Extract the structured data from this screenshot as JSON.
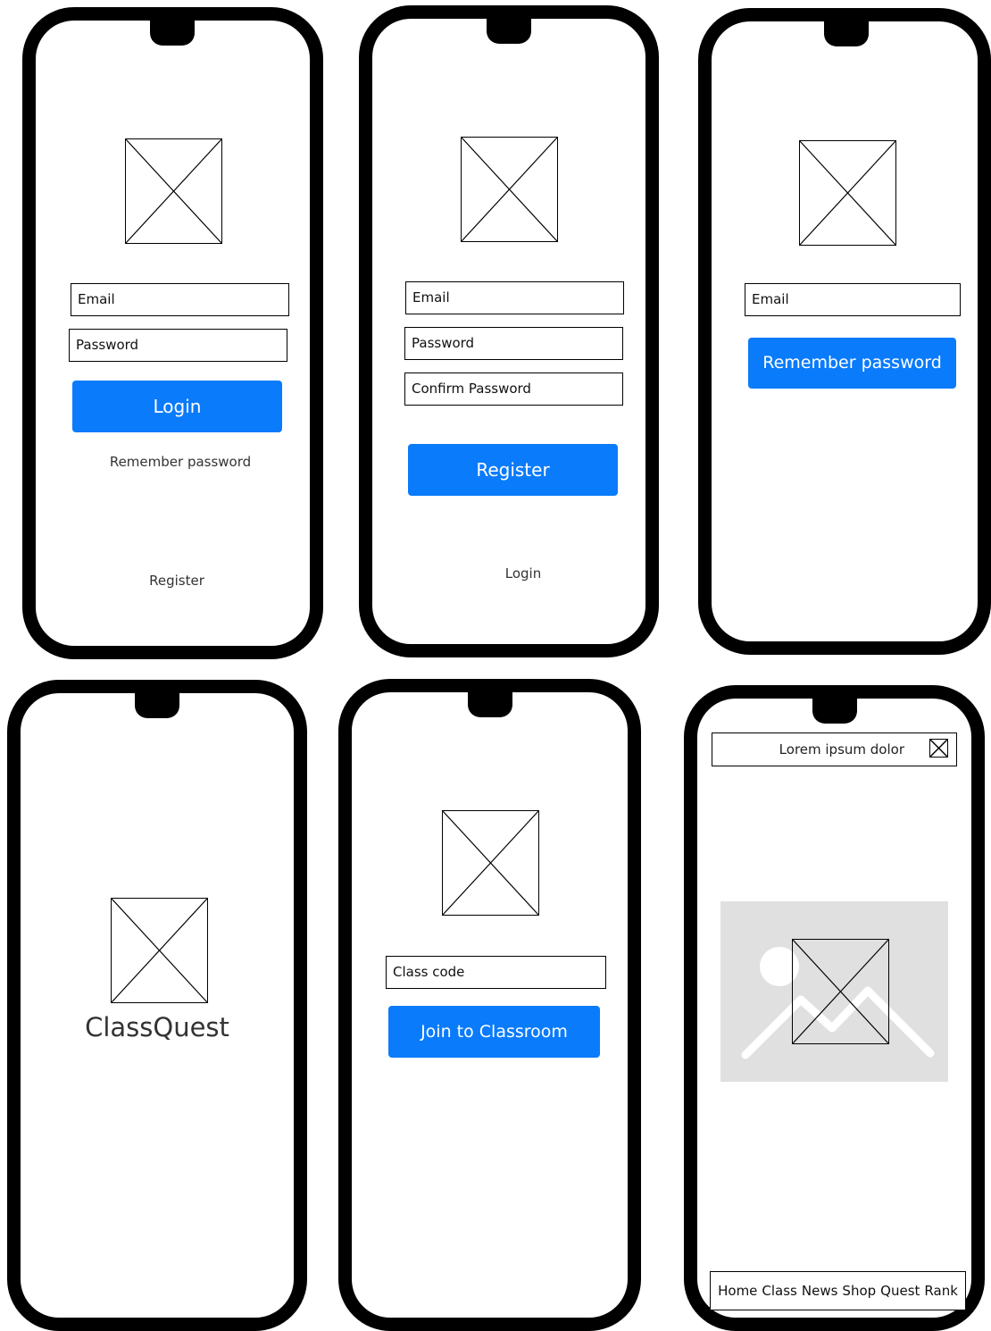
{
  "login_screen": {
    "email_placeholder": "Email",
    "password_placeholder": "Password",
    "login_button": "Login",
    "remember_link": "Remember password",
    "register_link": "Register",
    "logo_icon": "image-placeholder-icon"
  },
  "register_screen": {
    "email_placeholder": "Email",
    "password_placeholder": "Password",
    "confirm_password_placeholder": "Confirm Password",
    "register_button": "Register",
    "login_link": "Login",
    "logo_icon": "image-placeholder-icon"
  },
  "recover_screen": {
    "email_placeholder": "Email",
    "remember_button": "Remember password",
    "logo_icon": "image-placeholder-icon"
  },
  "splash_screen": {
    "app_name": "ClassQuest",
    "logo_icon": "image-placeholder-icon"
  },
  "join_screen": {
    "class_code_placeholder": "Class code",
    "join_button": "Join to Classroom",
    "logo_icon": "image-placeholder-icon"
  },
  "home_screen": {
    "banner_text": "Lorem ipsum dolor",
    "banner_close_icon": "close-box-icon",
    "image_icon": "image-icon",
    "tabs": [
      "Home",
      "Class",
      "News",
      "Shop",
      "Quest",
      "Rank"
    ]
  },
  "colors": {
    "primary_button": "#0a7bfb",
    "frame": "#000000",
    "image_placeholder_bg": "#e0e0e0"
  }
}
